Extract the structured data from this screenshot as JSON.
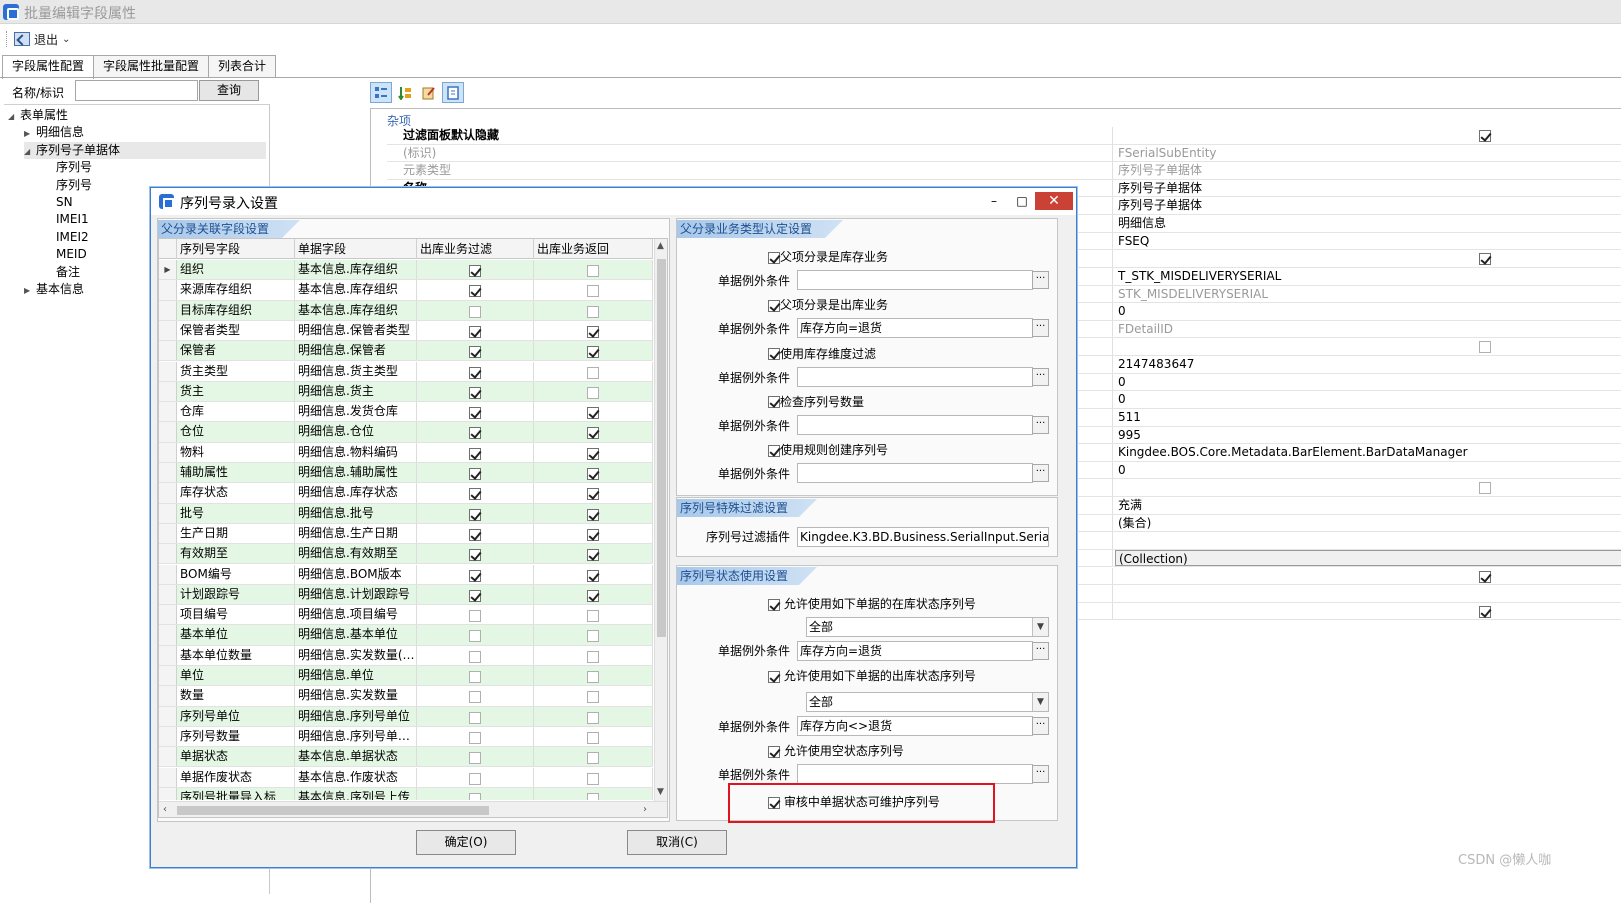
{
  "window": {
    "title": "批量编辑字段属性"
  },
  "toolbar": {
    "exit_label": "退出"
  },
  "tabs": [
    {
      "label": "字段属性配置",
      "active": true
    },
    {
      "label": "字段属性批量配置",
      "active": false
    },
    {
      "label": "列表合计",
      "active": false
    }
  ],
  "search": {
    "label": "名称/标识",
    "value": "",
    "button_label": "查询"
  },
  "tree": [
    {
      "label": "表单属性",
      "level": 0,
      "expander": "open",
      "selected": false
    },
    {
      "label": "明细信息",
      "level": 1,
      "expander": "closed",
      "selected": false
    },
    {
      "label": "序列号子单据体",
      "level": 1,
      "expander": "open",
      "selected": true
    },
    {
      "label": "序列号",
      "level": 2,
      "expander": "",
      "selected": false
    },
    {
      "label": "序列号",
      "level": 2,
      "expander": "",
      "selected": false
    },
    {
      "label": "SN",
      "level": 2,
      "expander": "",
      "selected": false
    },
    {
      "label": "IMEI1",
      "level": 2,
      "expander": "",
      "selected": false
    },
    {
      "label": "IMEI2",
      "level": 2,
      "expander": "",
      "selected": false
    },
    {
      "label": "MEID",
      "level": 2,
      "expander": "",
      "selected": false
    },
    {
      "label": "备注",
      "level": 2,
      "expander": "",
      "selected": false
    },
    {
      "label": "基本信息",
      "level": 1,
      "expander": "closed",
      "selected": false
    }
  ],
  "property_grid": {
    "category": "杂项",
    "rows": [
      {
        "name": "过滤面板默认隐藏",
        "name_style": "bold",
        "value": "",
        "value_style": "",
        "checkbox": "on"
      },
      {
        "name": "(标识)",
        "name_style": "gray",
        "value": "FSerialSubEntity",
        "value_style": "gray",
        "checkbox": ""
      },
      {
        "name": "元素类型",
        "name_style": "gray",
        "value": "序列号子单据体",
        "value_style": "gray",
        "checkbox": ""
      },
      {
        "name": "名称",
        "name_style": "bold",
        "value": "序列号子单据体",
        "value_style": "",
        "checkbox": ""
      },
      {
        "name": "",
        "name_style": "",
        "value": "序列号子单据体",
        "value_style": "",
        "checkbox": ""
      },
      {
        "name": "",
        "name_style": "",
        "value": "明细信息",
        "value_style": "",
        "checkbox": ""
      },
      {
        "name": "",
        "name_style": "",
        "value": "FSEQ",
        "value_style": "",
        "checkbox": ""
      },
      {
        "name": "",
        "name_style": "",
        "value": "",
        "value_style": "",
        "checkbox": "on"
      },
      {
        "name": "",
        "name_style": "",
        "value": "T_STK_MISDELIVERYSERIAL",
        "value_style": "",
        "checkbox": ""
      },
      {
        "name": "",
        "name_style": "",
        "value": "STK_MISDELIVERYSERIAL",
        "value_style": "gray",
        "checkbox": ""
      },
      {
        "name": "",
        "name_style": "",
        "value": "0",
        "value_style": "",
        "checkbox": ""
      },
      {
        "name": "",
        "name_style": "",
        "value": "FDetailID",
        "value_style": "gray",
        "checkbox": ""
      },
      {
        "name": "",
        "name_style": "",
        "value": "",
        "value_style": "",
        "checkbox": "off"
      },
      {
        "name": "",
        "name_style": "",
        "value": "2147483647",
        "value_style": "",
        "checkbox": ""
      },
      {
        "name": "",
        "name_style": "",
        "value": "0",
        "value_style": "",
        "checkbox": ""
      },
      {
        "name": "",
        "name_style": "",
        "value": "0",
        "value_style": "",
        "checkbox": ""
      },
      {
        "name": "",
        "name_style": "",
        "value": "511",
        "value_style": "",
        "checkbox": ""
      },
      {
        "name": "",
        "name_style": "",
        "value": "995",
        "value_style": "",
        "checkbox": ""
      },
      {
        "name": "",
        "name_style": "",
        "value": "Kingdee.BOS.Core.Metadata.BarElement.BarDataManager",
        "value_style": "",
        "checkbox": ""
      },
      {
        "name": "",
        "name_style": "",
        "value": "0",
        "value_style": "",
        "checkbox": ""
      },
      {
        "name": "",
        "name_style": "",
        "value": "",
        "value_style": "",
        "checkbox": "off"
      },
      {
        "name": "",
        "name_style": "",
        "value": "充满",
        "value_style": "",
        "checkbox": ""
      },
      {
        "name": "",
        "name_style": "",
        "value": "(集合)",
        "value_style": "",
        "checkbox": ""
      },
      {
        "name": "",
        "name_style": "",
        "value": "",
        "value_style": "",
        "checkbox": ""
      },
      {
        "name": "",
        "name_style": "",
        "value": "(Collection)",
        "value_style": "hl",
        "checkbox": ""
      },
      {
        "name": "",
        "name_style": "",
        "value": "",
        "value_style": "",
        "checkbox": "on"
      },
      {
        "name": "",
        "name_style": "",
        "value": "",
        "value_style": "",
        "checkbox": ""
      },
      {
        "name": "",
        "name_style": "",
        "value": "",
        "value_style": "",
        "checkbox": "on"
      }
    ]
  },
  "dialog": {
    "title": "序列号录入设置",
    "controls": {
      "minimize": "–",
      "maximize": "□",
      "close": "✕"
    },
    "left_section_title": "父分录关联字段设置",
    "grid": {
      "headers": [
        "序列号字段",
        "单据字段",
        "出库业务过滤",
        "出库业务返回"
      ],
      "rows": [
        {
          "field": "组织",
          "bill_field": "基本信息.库存组织",
          "filter": true,
          "return": false,
          "green": true,
          "current": true
        },
        {
          "field": "来源库存组织",
          "bill_field": "基本信息.库存组织",
          "filter": true,
          "return": false,
          "green": false,
          "current": false
        },
        {
          "field": "目标库存组织",
          "bill_field": "基本信息.库存组织",
          "filter": false,
          "return": false,
          "green": true,
          "current": false
        },
        {
          "field": "保管者类型",
          "bill_field": "明细信息.保管者类型",
          "filter": true,
          "return": true,
          "green": false,
          "current": false
        },
        {
          "field": "保管者",
          "bill_field": "明细信息.保管者",
          "filter": true,
          "return": true,
          "green": true,
          "current": false
        },
        {
          "field": "货主类型",
          "bill_field": "明细信息.货主类型",
          "filter": true,
          "return": false,
          "green": false,
          "current": false
        },
        {
          "field": "货主",
          "bill_field": "明细信息.货主",
          "filter": true,
          "return": false,
          "green": true,
          "current": false
        },
        {
          "field": "仓库",
          "bill_field": "明细信息.发货仓库",
          "filter": true,
          "return": true,
          "green": false,
          "current": false
        },
        {
          "field": "仓位",
          "bill_field": "明细信息.仓位",
          "filter": true,
          "return": true,
          "green": true,
          "current": false
        },
        {
          "field": "物料",
          "bill_field": "明细信息.物料编码",
          "filter": true,
          "return": true,
          "green": false,
          "current": false
        },
        {
          "field": "辅助属性",
          "bill_field": "明细信息.辅助属性",
          "filter": true,
          "return": true,
          "green": true,
          "current": false
        },
        {
          "field": "库存状态",
          "bill_field": "明细信息.库存状态",
          "filter": true,
          "return": true,
          "green": false,
          "current": false
        },
        {
          "field": "批号",
          "bill_field": "明细信息.批号",
          "filter": true,
          "return": true,
          "green": true,
          "current": false
        },
        {
          "field": "生产日期",
          "bill_field": "明细信息.生产日期",
          "filter": true,
          "return": true,
          "green": false,
          "current": false
        },
        {
          "field": "有效期至",
          "bill_field": "明细信息.有效期至",
          "filter": true,
          "return": true,
          "green": true,
          "current": false
        },
        {
          "field": "BOM编号",
          "bill_field": "明细信息.BOM版本",
          "filter": true,
          "return": true,
          "green": false,
          "current": false
        },
        {
          "field": "计划跟踪号",
          "bill_field": "明细信息.计划跟踪号",
          "filter": true,
          "return": true,
          "green": true,
          "current": false
        },
        {
          "field": "项目编号",
          "bill_field": "明细信息.项目编号",
          "filter": false,
          "return": false,
          "green": false,
          "current": false
        },
        {
          "field": "基本单位",
          "bill_field": "明细信息.基本单位",
          "filter": false,
          "return": false,
          "green": true,
          "current": false
        },
        {
          "field": "基本单位数量",
          "bill_field": "明细信息.实发数量(…",
          "filter": false,
          "return": false,
          "green": false,
          "current": false
        },
        {
          "field": "单位",
          "bill_field": "明细信息.单位",
          "filter": false,
          "return": false,
          "green": true,
          "current": false
        },
        {
          "field": "数量",
          "bill_field": "明细信息.实发数量",
          "filter": false,
          "return": false,
          "green": false,
          "current": false
        },
        {
          "field": "序列号单位",
          "bill_field": "明细信息.序列号单位",
          "filter": false,
          "return": false,
          "green": true,
          "current": false
        },
        {
          "field": "序列号数量",
          "bill_field": "明细信息.序列号单…",
          "filter": false,
          "return": false,
          "green": false,
          "current": false
        },
        {
          "field": "单据状态",
          "bill_field": "基本信息.单据状态",
          "filter": false,
          "return": false,
          "green": true,
          "current": false
        },
        {
          "field": "单据作废状态",
          "bill_field": "基本信息.作废状态",
          "filter": false,
          "return": false,
          "green": false,
          "current": false
        },
        {
          "field": "序列号批量导入标",
          "bill_field": "基本信息.序列号上传",
          "filter": false,
          "return": false,
          "green": true,
          "current": false
        }
      ]
    },
    "biz_section_title": "父分录业务类型认定设置",
    "biz_rows": [
      {
        "checkbox_label": "父项分录是库存业务",
        "checked": true,
        "cond_label": "单据例外条件",
        "cond_value": ""
      },
      {
        "checkbox_label": "父项分录是出库业务",
        "checked": true,
        "cond_label": "单据例外条件",
        "cond_value": "库存方向=退货"
      },
      {
        "checkbox_label": "使用库存维度过滤",
        "checked": true,
        "cond_label": "单据例外条件",
        "cond_value": ""
      },
      {
        "checkbox_label": "检查序列号数量",
        "checked": true,
        "cond_label": "单据例外条件",
        "cond_value": ""
      },
      {
        "checkbox_label": "使用规则创建序列号",
        "checked": true,
        "cond_label": "单据例外条件",
        "cond_value": ""
      }
    ],
    "special_section_title": "序列号特殊过滤设置",
    "plugin_label": "序列号过滤插件",
    "plugin_value": "Kingdee.K3.BD.Business.SerialInput.SerialFilter.",
    "status_section_title": "序列号状态使用设置",
    "status_rows": {
      "instock_label": "允许使用如下单据的在库状态序列号",
      "instock_checked": true,
      "instock_select": "全部",
      "instock_cond_label": "单据例外条件",
      "instock_cond_value": "库存方向=退货",
      "outstock_label": "允许使用如下单据的出库状态序列号",
      "outstock_checked": true,
      "outstock_select": "全部",
      "outstock_cond_label": "单据例外条件",
      "outstock_cond_value": "库存方向<>退货",
      "empty_label": "允许使用空状态序列号",
      "empty_checked": true,
      "empty_cond_label": "单据例外条件",
      "empty_cond_value": "",
      "audit_label": "审核中单据状态可维护序列号",
      "audit_checked": true
    },
    "ok_label": "确定(O)",
    "cancel_label": "取消(C)"
  },
  "watermark": "CSDN @懒人咖",
  "colors": {
    "accent": "#2a6fd6",
    "green_row": "#e4f7e4",
    "highlight_box": "#e0141e",
    "section_header": "#a8c8ea"
  }
}
